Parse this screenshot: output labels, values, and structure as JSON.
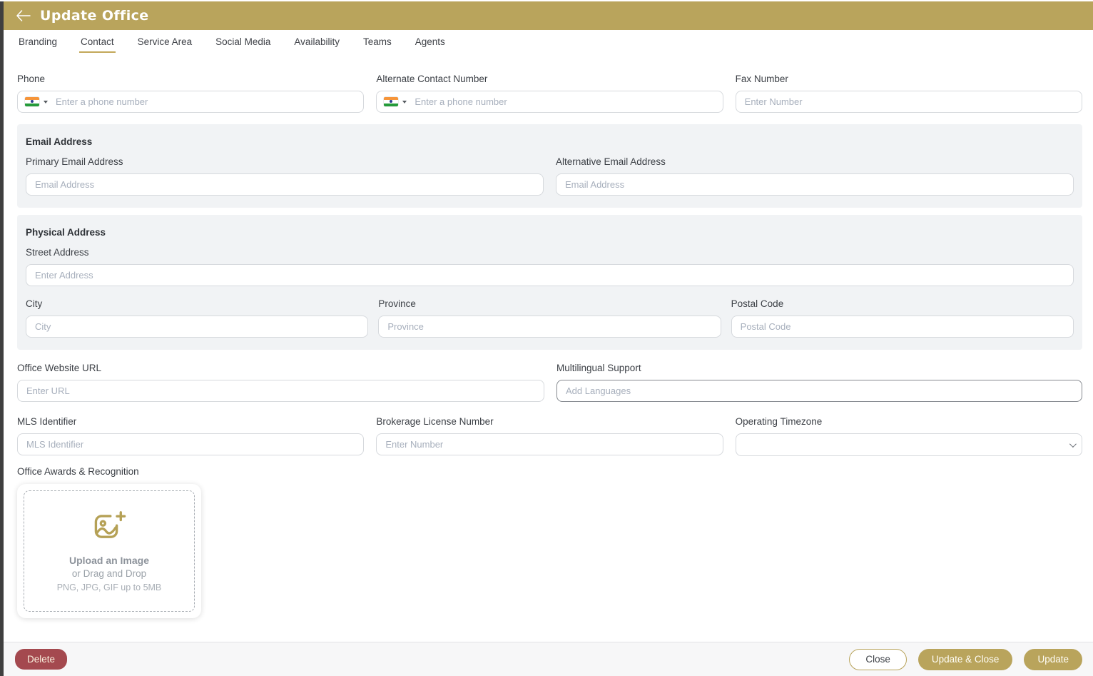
{
  "header": {
    "title": "Update Office"
  },
  "tabs": [
    {
      "label": "Branding"
    },
    {
      "label": "Contact"
    },
    {
      "label": "Service Area"
    },
    {
      "label": "Social Media"
    },
    {
      "label": "Availability"
    },
    {
      "label": "Teams"
    },
    {
      "label": "Agents"
    }
  ],
  "contact_row": {
    "phone": {
      "label": "Phone",
      "placeholder": "Enter a phone number",
      "country": "India"
    },
    "alternate": {
      "label": "Alternate Contact Number",
      "placeholder": "Enter a phone number",
      "country": "India"
    },
    "fax": {
      "label": "Fax Number",
      "placeholder": "Enter Number"
    }
  },
  "email_section": {
    "title": "Email Address",
    "primary": {
      "label": "Primary Email Address",
      "placeholder": "Email Address"
    },
    "alternative": {
      "label": "Alternative Email Address",
      "placeholder": "Email Address"
    }
  },
  "address_section": {
    "title": "Physical Address",
    "street": {
      "label": "Street Address",
      "placeholder": "Enter Address"
    },
    "city": {
      "label": "City",
      "placeholder": "City"
    },
    "province": {
      "label": "Province",
      "placeholder": "Province"
    },
    "postal": {
      "label": "Postal Code",
      "placeholder": "Postal Code"
    }
  },
  "website": {
    "label": "Office Website URL",
    "placeholder": "Enter URL"
  },
  "multilingual": {
    "label": "Multilingual Support",
    "placeholder": "Add Languages"
  },
  "mls": {
    "label": "MLS Identifier",
    "placeholder": "MLS Identifier"
  },
  "brokerage": {
    "label": "Brokerage License Number",
    "placeholder": "Enter Number"
  },
  "timezone": {
    "label": "Operating Timezone",
    "value": ""
  },
  "awards": {
    "label": "Office Awards & Recognition",
    "upload_title": "Upload an Image",
    "upload_subtitle": "or Drag and Drop",
    "upload_hint": "PNG, JPG, GIF up to 5MB"
  },
  "footer": {
    "delete": "Delete",
    "close": "Close",
    "update_and_close": "Update & Close",
    "update": "Update"
  },
  "colors": {
    "accent_gold": "#b9a45c",
    "delete_red": "#a4494f",
    "section_bg": "#f1f3f5",
    "sidebar_strip": "#3f3f3f"
  }
}
